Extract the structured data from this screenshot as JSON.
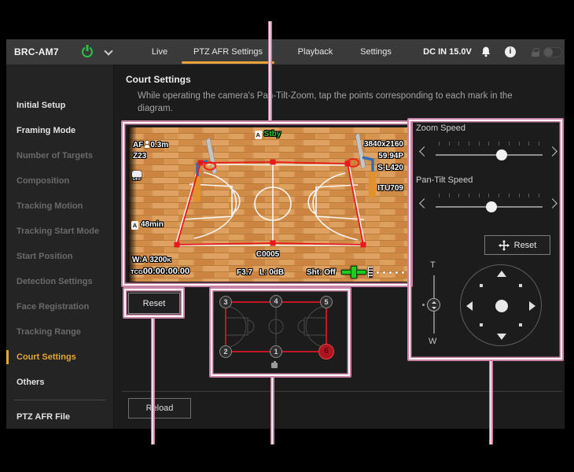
{
  "topbar": {
    "brand": "BRC-AM7",
    "tabs": [
      {
        "label": "Live",
        "active": false
      },
      {
        "label": "PTZ AFR Settings",
        "active": true
      },
      {
        "label": "Playback",
        "active": false
      },
      {
        "label": "Settings",
        "active": false
      }
    ],
    "power_source": "DC IN 15.0V",
    "info_glyph": "i"
  },
  "sidebar": {
    "items": [
      {
        "label": "Initial Setup",
        "state": "enabled"
      },
      {
        "label": "Framing Mode",
        "state": "enabled"
      },
      {
        "label": "Number of Targets",
        "state": "disabled"
      },
      {
        "label": "Composition",
        "state": "disabled"
      },
      {
        "label": "Tracking Motion",
        "state": "disabled"
      },
      {
        "label": "Tracking Start Mode",
        "state": "disabled"
      },
      {
        "label": "Start Position",
        "state": "disabled"
      },
      {
        "label": "Detection Settings",
        "state": "disabled"
      },
      {
        "label": "Face Registration",
        "state": "disabled"
      },
      {
        "label": "Tracking Range",
        "state": "disabled"
      },
      {
        "label": "Court Settings",
        "state": "active"
      },
      {
        "label": "Others",
        "state": "enabled"
      },
      {
        "label": "PTZ AFR File",
        "state": "enabled"
      }
    ]
  },
  "main": {
    "title": "Court Settings",
    "instruction": "While operating the camera's Pan-Tilt-Zoom, tap the points corresponding to each mark in the diagram.",
    "court_reset_label": "Reset",
    "reload_label": "Reload"
  },
  "camera_view": {
    "record_status": "Stby",
    "slot_label": "A",
    "focus_mode": "AF",
    "focus_distance": "0.3m",
    "zoom_position": "Z23",
    "stabilizer": "OFF",
    "media_slot": "A",
    "media_remaining": "48min",
    "clip_number": "C0005",
    "white_balance": "W:A 3200",
    "white_balance_unit": "K",
    "timecode_label": "TCG",
    "timecode": "00:00:00.00",
    "iris": "F3.7",
    "gain": "L:  0dB",
    "shutter": "Sht: Off",
    "resolution": "3840x2160",
    "frame_rate": "59.94P",
    "gamma": "S-L420",
    "color_space": "ITU709"
  },
  "point_diagram": {
    "points": [
      "1",
      "2",
      "3",
      "4",
      "5",
      "6"
    ],
    "selected_point": "6"
  },
  "right_panel": {
    "zoom_speed_label": "Zoom Speed",
    "pan_tilt_speed_label": "Pan-Tilt Speed",
    "zoom_speed_pct": 62,
    "pan_tilt_speed_pct": 52,
    "reset_label": "Reset",
    "tele_label": "T",
    "wide_label": "W"
  },
  "colors": {
    "accent_orange": "#e8a33b",
    "annotation_pink": "#c882a5",
    "status_green": "#2ec72e",
    "overlay_red": "#e7191f"
  }
}
